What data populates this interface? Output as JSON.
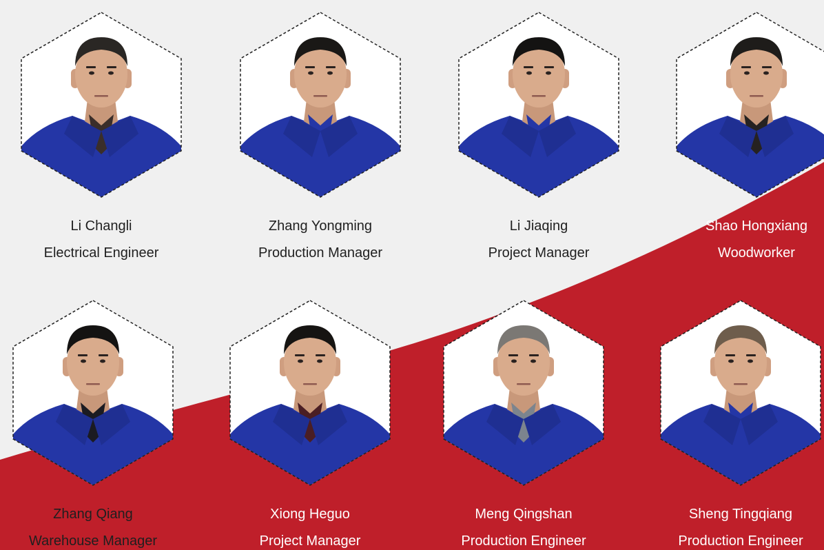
{
  "theme": {
    "background": "#f0f0f0",
    "accent_red": "#bf1f2a",
    "uniform_blue": "#2436a6",
    "frame_fill": "#ffffff",
    "frame_stroke": "#222222"
  },
  "team": [
    {
      "name": "Li Changli",
      "role": "Electrical Engineer",
      "hair": "#2a2724",
      "shirt": "#3a2e2a"
    },
    {
      "name": "Zhang Yongming",
      "role": "Production Manager",
      "hair": "#1a1816",
      "shirt": "#2436a6"
    },
    {
      "name": "Li Jiaqing",
      "role": "Project Manager",
      "hair": "#141312",
      "shirt": "#2436a6"
    },
    {
      "name": "Shao Hongxiang",
      "role": "Woodworker",
      "hair": "#1e1c1a",
      "shirt": "#262221"
    },
    {
      "name": "Zhang Qiang",
      "role": "Warehouse Manager",
      "hair": "#141312",
      "shirt": "#1b1b22"
    },
    {
      "name": "Xiong Heguo",
      "role": "Project Manager",
      "hair": "#161412",
      "shirt": "#4a1e24"
    },
    {
      "name": "Meng Qingshan",
      "role": "Production Engineer",
      "hair": "#7b7874",
      "shirt": "#7c848e"
    },
    {
      "name": "Sheng Tingqiang",
      "role": "Production Engineer",
      "hair": "#6e5d4c",
      "shirt": "#2436a6"
    }
  ]
}
